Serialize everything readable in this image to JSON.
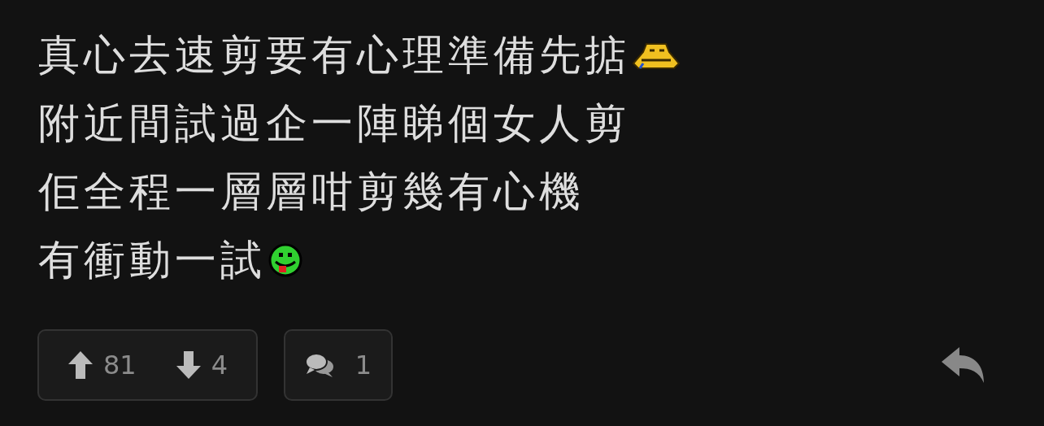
{
  "post": {
    "lines": [
      {
        "text": "真心去速剪要有心理準備先掂",
        "emoticon": {
          "kind": "laughing"
        }
      },
      {
        "text": "附近間試過企一陣睇個女人剪"
      },
      {
        "text": "佢全程一層層咁剪幾有心機"
      },
      {
        "text": "有衝動一試",
        "emoticon": {
          "kind": "tongue"
        }
      }
    ]
  },
  "actions": {
    "upvotes": "81",
    "downvotes": "4",
    "comments": "1"
  }
}
